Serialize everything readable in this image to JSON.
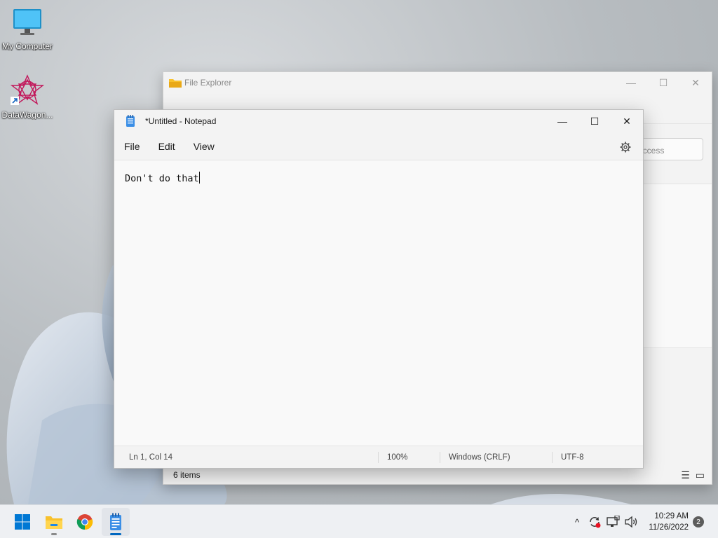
{
  "desktop": {
    "icons": [
      {
        "label": "My Computer",
        "icon": "monitor-icon"
      },
      {
        "label": "DataWagon...",
        "icon": "datawagon-app-icon"
      }
    ]
  },
  "explorer": {
    "title": "File Explorer",
    "search_placeholder": "access",
    "status_items": "6 items",
    "controls": {
      "minimize": "—",
      "maximize": "☐",
      "close": "✕"
    }
  },
  "notepad": {
    "title": "*Untitled - Notepad",
    "menu": {
      "file": "File",
      "edit": "Edit",
      "view": "View"
    },
    "controls": {
      "minimize": "—",
      "maximize": "☐",
      "close": "✕"
    },
    "content": "Don't do that",
    "status": {
      "position": "Ln 1, Col 14",
      "zoom": "100%",
      "line_ending": "Windows (CRLF)",
      "encoding": "UTF-8"
    }
  },
  "taskbar": {
    "apps": [
      "windows-start-icon",
      "file-explorer-icon",
      "chrome-icon",
      "notepad-icon"
    ],
    "tray": {
      "time": "10:29 AM",
      "date": "11/26/2022",
      "notification_count": "2"
    }
  },
  "colors": {
    "accent": "#0067c0",
    "taskbar": "#eef0f3"
  }
}
